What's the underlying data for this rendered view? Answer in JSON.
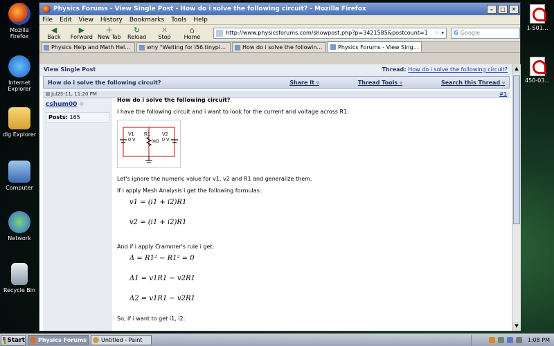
{
  "desktop": {
    "left_icons": [
      {
        "label": "Mozilla Firefox"
      },
      {
        "label": "Internet Explorer"
      },
      {
        "label": "dlg Explorer"
      },
      {
        "label": "Computer"
      },
      {
        "label": "Network"
      },
      {
        "label": "Recycle Bin"
      }
    ],
    "right_icons": [
      {
        "label": "1-S01..."
      },
      {
        "label": "450-03..."
      }
    ]
  },
  "window": {
    "title": "Physics Forums - View Single Post - How do i solve the following circuit? - Mozilla Firefox"
  },
  "menu": [
    "File",
    "Edit",
    "View",
    "History",
    "Bookmarks",
    "Tools",
    "Help"
  ],
  "toolbar": {
    "back": "Back",
    "forward": "Forward",
    "newtab": "New Tab",
    "reload": "Reload",
    "stop": "Stop",
    "home": "Home",
    "url": "http://www.physicsforums.com/showpost.php?p=3421585&postcount=1",
    "search_placeholder": "Google"
  },
  "tabs": [
    {
      "label": "Physics Help and Math Help - Ph..."
    },
    {
      "label": "why \"Waiting for i56.tinypic.com\""
    },
    {
      "label": "How do i solve the following circ..."
    },
    {
      "label": "Physics Forums - View Single Po..."
    }
  ],
  "page": {
    "view_single_post": "View Single Post",
    "thread_label": "Thread:",
    "thread_link": "How do i solve the following circuit?",
    "header_title": "How do i solve the following circuit?",
    "share_it": "Share It",
    "thread_tools": "Thread Tools",
    "search_thread": "Search this Thread",
    "post_date": "Jul25-11, 11:20 PM",
    "post_number": "#1",
    "username": "cshum00",
    "posts_label": "Posts:",
    "posts_count": "165",
    "post_title": "How do i solve the following circuit?",
    "p1": "I have the following circuit and i want to look for the current and voltage across R1:",
    "p2": "Let's ignore the numeric value for v1, v2 and R1 and generalize them.",
    "p3": "If i apply Mesh Analysis i get the following formulas:",
    "eq1": "v1 = (i1 + i2)R1",
    "eq2": "v2 = (i1 + i2)R1",
    "p4": "And if i apply Crammer's rule i get:",
    "eq3": "Δ = R1² − R1² = 0",
    "eq4": "Δ1 = v1R1 − v2R1",
    "eq5": "Δ2 = v1R1 − v2R1",
    "p5": "So, if i want to get i1, i2:",
    "circuit": {
      "v1": "V1",
      "v1_val": "0 V",
      "r1": "R1",
      "r1_val": "0kΩ",
      "v2": "V2",
      "v2_val": "0 V"
    }
  },
  "taskbar": {
    "start": "Start",
    "tasks": [
      {
        "label": "Physics Forums -..."
      },
      {
        "label": "Untitled - Paint"
      }
    ],
    "clock": "1:08 PM"
  }
}
